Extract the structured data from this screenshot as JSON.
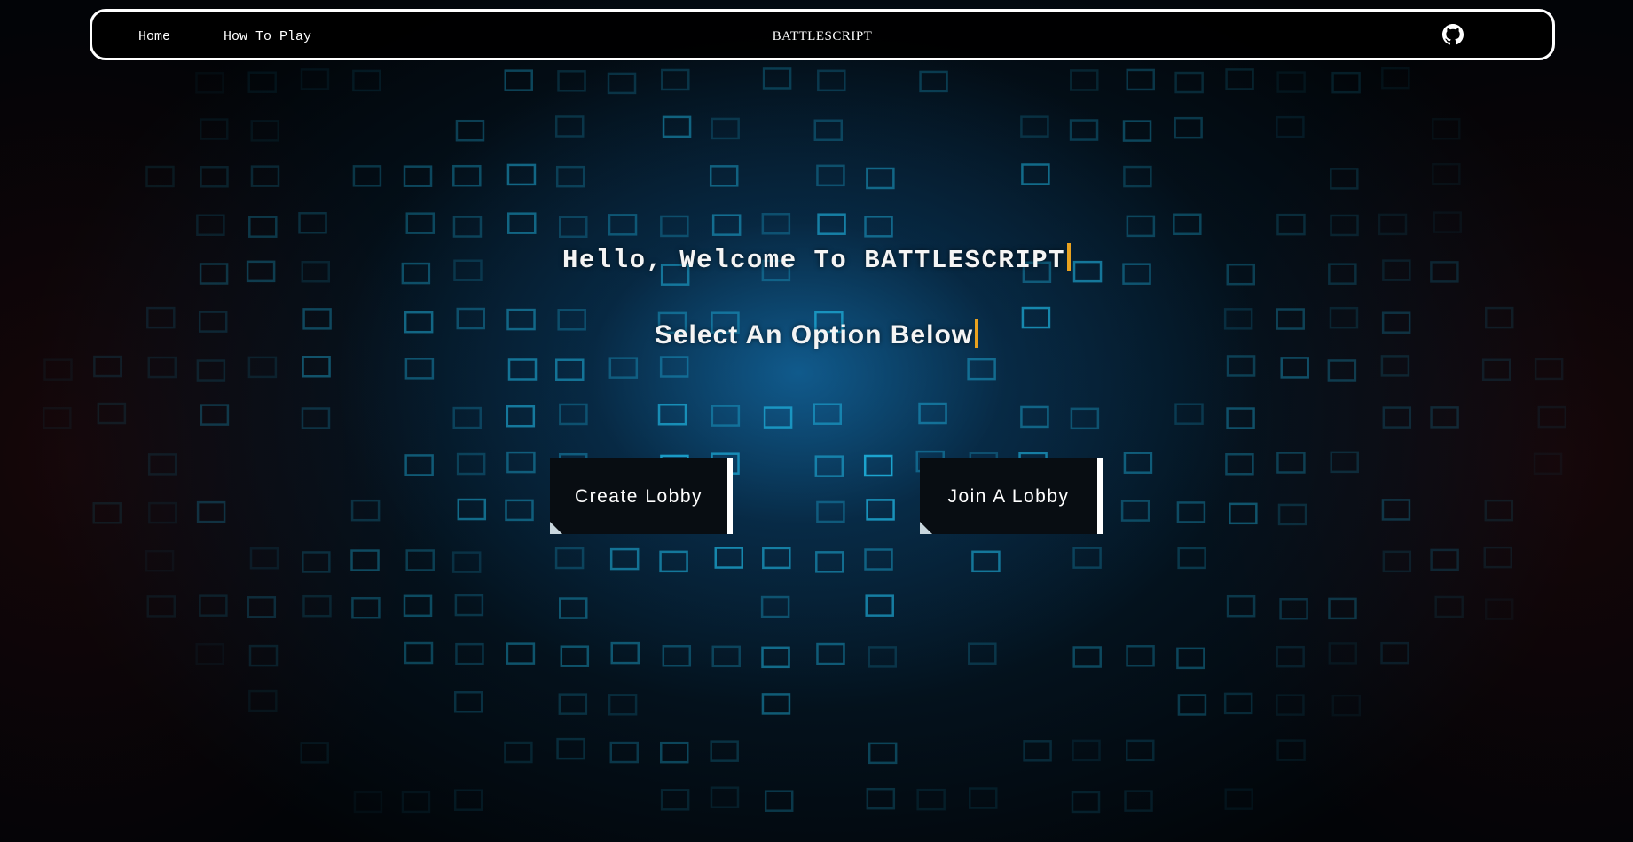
{
  "navbar": {
    "home_label": "Home",
    "how_to_play_label": "How To Play",
    "brand": "BATTLESCRIPT",
    "github_icon": "github-icon"
  },
  "hero": {
    "welcome": "Hello, Welcome To BATTLESCRIPT",
    "subtitle": "Select An Option Below",
    "caret_color": "#e9a21f"
  },
  "actions": {
    "create_label": "Create Lobby",
    "join_label": "Join A Lobby"
  },
  "colors": {
    "accent": "#e9a21f",
    "glow": "#1aa9d6",
    "button_bg": "#080d12"
  }
}
